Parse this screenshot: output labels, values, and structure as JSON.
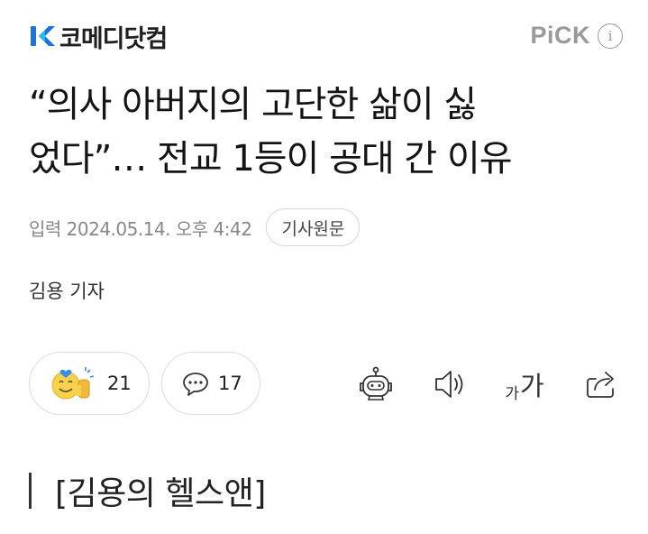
{
  "header": {
    "logo_text": "코메디닷컴",
    "pick_label": "PiCK",
    "info_glyph": "i",
    "brand_color": "#1e73d8"
  },
  "article": {
    "title_line1": "“의사 아버지의 고단한 삶이 싫",
    "title_line2": "었다”… 전교 1등이 공대 간 이유",
    "date": "입력 2024.05.14. 오후 4:42",
    "origin_label": "기사원문",
    "reporter": "김용 기자",
    "section_heading": "[김용의 헬스앤]"
  },
  "actions": {
    "reaction_count": "21",
    "comment_count": "17",
    "font_small": "가",
    "font_big": "가",
    "icons": [
      "reaction-emoji-icon",
      "comment-icon",
      "robot-summary-icon",
      "speaker-icon",
      "font-size-icon",
      "share-icon"
    ]
  }
}
